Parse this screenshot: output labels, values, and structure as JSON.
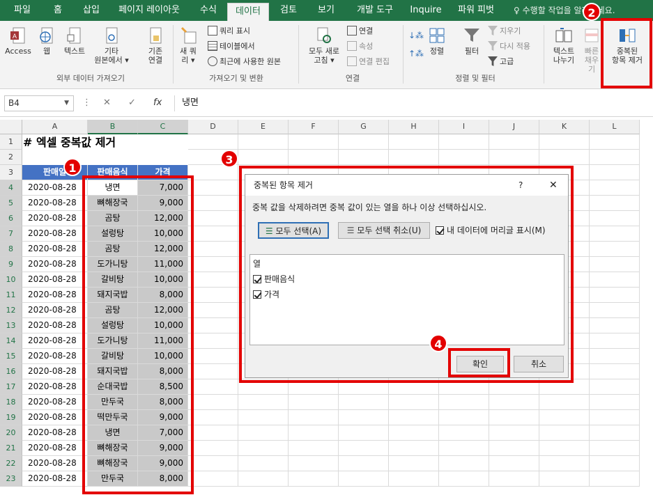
{
  "ribbon_tabs": [
    "파일",
    "홈",
    "삽입",
    "페이지 레이아웃",
    "수식",
    "데이터",
    "검토",
    "보기",
    "개발 도구",
    "Inquire",
    "파워 피벗"
  ],
  "active_tab": "데이터",
  "tell_me": "수행할 작업을 알려주세요.",
  "ribbon": {
    "access": "Access",
    "web": "웹",
    "text": "텍스트",
    "other1": "기타",
    "other2": "원본에서 ▾",
    "existing1": "기존",
    "existing2": "연결",
    "newq1": "새 쿼",
    "newq2": "리 ▾",
    "show_queries": "쿼리 표시",
    "from_table": "테이블에서",
    "recent": "최근에 사용한 원본",
    "refresh1": "모두 새로",
    "refresh2": "고침 ▾",
    "connections": "연결",
    "properties": "속성",
    "edit_links": "연결 편집",
    "sort": "정렬",
    "filter": "필터",
    "clear": "지우기",
    "reapply": "다시 적용",
    "advanced": "고급",
    "text_cols1": "텍스트",
    "text_cols2": "나누기",
    "flash1": "빠른",
    "flash2": "채우기",
    "remove_dup1": "중복된",
    "remove_dup2": "항목 제거",
    "group_external": "외부 데이터 가져오기",
    "group_transform": "가져오기 및 변환",
    "group_conn": "연결",
    "group_sort": "정렬 및 필터"
  },
  "formula_bar": {
    "cell_ref": "B4",
    "fx": "fx",
    "value": "냉면"
  },
  "columns": [
    "A",
    "B",
    "C",
    "D",
    "E",
    "F",
    "G",
    "H",
    "I",
    "J",
    "K",
    "L"
  ],
  "sheet_title": "# 엑셀 중복값 제거",
  "headers": [
    "판매일",
    "판매음식",
    "가격"
  ],
  "rows": [
    [
      "2020-08-28",
      "냉면",
      "7,000"
    ],
    [
      "2020-08-28",
      "뼈해장국",
      "9,000"
    ],
    [
      "2020-08-28",
      "곰탕",
      "12,000"
    ],
    [
      "2020-08-28",
      "설렁탕",
      "10,000"
    ],
    [
      "2020-08-28",
      "곰탕",
      "12,000"
    ],
    [
      "2020-08-28",
      "도가니탕",
      "11,000"
    ],
    [
      "2020-08-28",
      "갈비탕",
      "10,000"
    ],
    [
      "2020-08-28",
      "돼지국밥",
      "8,000"
    ],
    [
      "2020-08-28",
      "곰탕",
      "12,000"
    ],
    [
      "2020-08-28",
      "설렁탕",
      "10,000"
    ],
    [
      "2020-08-28",
      "도가니탕",
      "11,000"
    ],
    [
      "2020-08-28",
      "갈비탕",
      "10,000"
    ],
    [
      "2020-08-28",
      "돼지국밥",
      "8,000"
    ],
    [
      "2020-08-28",
      "순대국밥",
      "8,500"
    ],
    [
      "2020-08-28",
      "만두국",
      "8,000"
    ],
    [
      "2020-08-28",
      "떡만두국",
      "9,000"
    ],
    [
      "2020-08-28",
      "냉면",
      "7,000"
    ],
    [
      "2020-08-28",
      "뼈해장국",
      "9,000"
    ],
    [
      "2020-08-28",
      "뼈해장국",
      "9,000"
    ],
    [
      "2020-08-28",
      "만두국",
      "8,000"
    ]
  ],
  "dialog": {
    "title": "중복된 항목 제거",
    "help": "?",
    "close": "✕",
    "instruction": "중복 값을 삭제하려면 중복 값이 있는 열을 하나 이상 선택하십시오.",
    "select_all": "모두 선택(A)",
    "unselect_all": "모두 선택 취소(U)",
    "has_headers": "내 데이터에 머리글 표시(M)",
    "col_header": "열",
    "col1": "판매음식",
    "col2": "가격",
    "ok": "확인",
    "cancel": "취소"
  },
  "badges": [
    "1",
    "2",
    "3",
    "4"
  ],
  "colors": {
    "excel_green": "#217346",
    "highlight_red": "#e30000",
    "header_blue": "#4472c4"
  }
}
